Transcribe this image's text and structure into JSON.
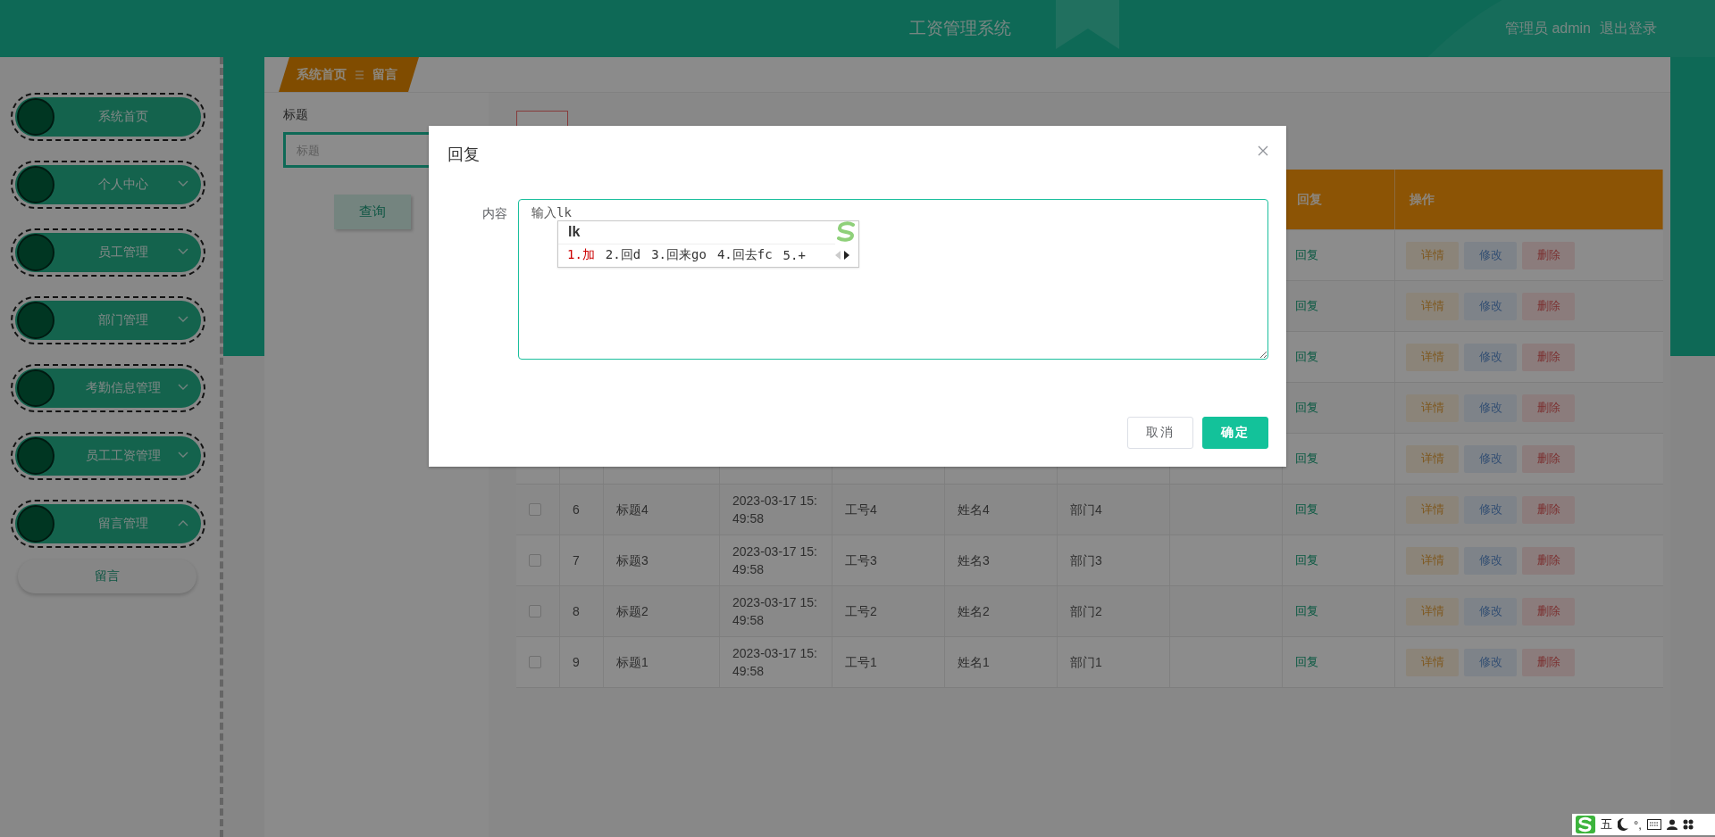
{
  "header": {
    "title": "工资管理系统",
    "user": "管理员 admin",
    "logout": "退出登录"
  },
  "sidebar": {
    "items": [
      {
        "label": "系统首页",
        "kind": "link"
      },
      {
        "label": "个人中心",
        "kind": "group",
        "expanded": false
      },
      {
        "label": "员工管理",
        "kind": "group",
        "expanded": false
      },
      {
        "label": "部门管理",
        "kind": "group",
        "expanded": false
      },
      {
        "label": "考勤信息管理",
        "kind": "group",
        "expanded": false
      },
      {
        "label": "员工工资管理",
        "kind": "group",
        "expanded": false
      },
      {
        "label": "留言管理",
        "kind": "group",
        "expanded": true,
        "children": [
          {
            "label": "留言",
            "selected": true
          }
        ]
      }
    ]
  },
  "breadcrumb": [
    "系统首页",
    "留言"
  ],
  "filter": {
    "label": "标题",
    "placeholder": "标题",
    "button": "查询"
  },
  "table": {
    "columns": [
      {
        "label": "回复"
      },
      {
        "label": "操作"
      }
    ],
    "rows": [
      {
        "reply": "回复",
        "actions": [
          "详情",
          "修改",
          "删除"
        ]
      },
      {
        "reply": "回复",
        "actions": [
          "详情",
          "修改",
          "删除"
        ]
      },
      {
        "reply": "回复",
        "actions": [
          "详情",
          "修改",
          "删除"
        ]
      },
      {
        "reply": "回复",
        "actions": [
          "详情",
          "修改",
          "删除"
        ]
      },
      {
        "reply": "回复",
        "actions": [
          "详情",
          "修改",
          "删除"
        ]
      },
      {
        "checked": false,
        "index": "6",
        "title": "标题4",
        "time": "2023-03-17 15:49:58",
        "job_no": "工号4",
        "name": "姓名4",
        "dept": "部门4",
        "reply": "回复",
        "actions": [
          "详情",
          "修改",
          "删除"
        ]
      },
      {
        "checked": false,
        "index": "7",
        "title": "标题3",
        "time": "2023-03-17 15:49:58",
        "job_no": "工号3",
        "name": "姓名3",
        "dept": "部门3",
        "reply": "回复",
        "actions": [
          "详情",
          "修改",
          "删除"
        ]
      },
      {
        "checked": false,
        "index": "8",
        "title": "标题2",
        "time": "2023-03-17 15:49:58",
        "job_no": "工号2",
        "name": "姓名2",
        "dept": "部门2",
        "reply": "回复",
        "actions": [
          "详情",
          "修改",
          "删除"
        ]
      },
      {
        "checked": false,
        "index": "9",
        "title": "标题1",
        "time": "2023-03-17 15:49:58",
        "job_no": "工号1",
        "name": "姓名1",
        "dept": "部门1",
        "reply": "回复",
        "actions": [
          "详情",
          "修改",
          "删除"
        ]
      }
    ]
  },
  "dialog": {
    "title": "回复",
    "field_label": "内容",
    "value": "输入lk",
    "cancel": "取消",
    "confirm": "确定"
  },
  "ime": {
    "composition": "lk",
    "candidates": [
      {
        "label": "1.加",
        "selected": true
      },
      {
        "label": "2.回d",
        "selected": false
      },
      {
        "label": "3.回来go",
        "selected": false
      },
      {
        "label": "4.回去fc",
        "selected": false
      },
      {
        "label": "5.+",
        "selected": false
      }
    ]
  },
  "ime_status": {
    "mode": "五",
    "punct": "°,"
  }
}
